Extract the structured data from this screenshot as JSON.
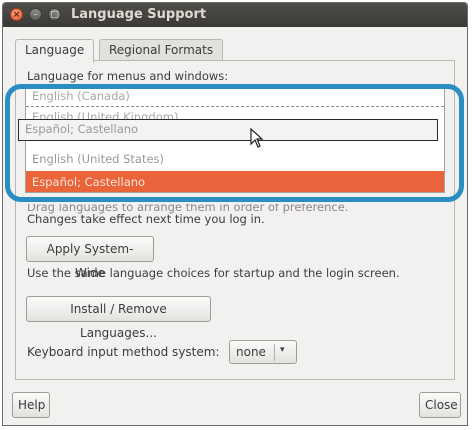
{
  "window": {
    "title": "Language Support",
    "close_glyph": "×",
    "min_glyph": "–",
    "max_glyph": "□"
  },
  "tabs": [
    {
      "label": "Language",
      "active": true
    },
    {
      "label": "Regional Formats",
      "active": false
    }
  ],
  "language_section": {
    "heading": "Language for menus and windows:",
    "list_items": [
      {
        "label": "English (Canada)",
        "state": "faded"
      },
      {
        "label": "English (United Kingdom)",
        "state": "faded"
      },
      {
        "label": "English (United States)",
        "state": "normal"
      },
      {
        "label": "Español; Castellano",
        "state": "selected"
      }
    ],
    "drag_ghost_label": "Español; Castellano",
    "hint_line1": "Drag languages to arrange them in order of preference.",
    "hint_line2": "Changes take effect next time you log in."
  },
  "apply_button": {
    "label": "Apply System-Wide"
  },
  "apply_hint": "Use the same language choices for startup and the login screen.",
  "install_button": {
    "label": "Install / Remove Languages..."
  },
  "keyboard": {
    "label": "Keyboard input method system:",
    "value": "none",
    "arrow_glyph": "▾"
  },
  "footer": {
    "help_label": "Help",
    "close_label": "Close"
  },
  "colors": {
    "selection": "#e9643a",
    "highlight_ring": "#2a8dc4",
    "titlebar": "#3b3a36"
  }
}
